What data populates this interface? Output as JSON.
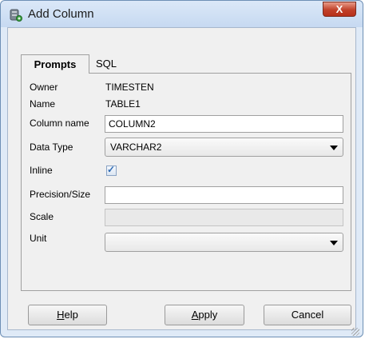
{
  "window": {
    "title": "Add Column",
    "close_label": "X"
  },
  "tabs": [
    {
      "label": "Prompts",
      "selected": true
    },
    {
      "label": "SQL",
      "selected": false
    }
  ],
  "form": {
    "owner_label": "Owner",
    "owner_value": "TIMESTEN",
    "name_label": "Name",
    "name_value": "TABLE1",
    "column_name_label": "Column name",
    "column_name_value": "COLUMN2",
    "data_type_label": "Data Type",
    "data_type_value": "VARCHAR2",
    "inline_label": "Inline",
    "inline_checked": true,
    "precision_label": "Precision/Size",
    "precision_value": "",
    "scale_label": "Scale",
    "scale_value": "",
    "unit_label": "Unit",
    "unit_value": ""
  },
  "buttons": {
    "help": {
      "mnemonic": "H",
      "rest": "elp"
    },
    "apply": {
      "mnemonic": "A",
      "rest": "pply"
    },
    "cancel": "Cancel"
  },
  "colors": {
    "accent": "#2f6bb3",
    "close": "#c1412a",
    "frame": "#dfeaf7"
  }
}
